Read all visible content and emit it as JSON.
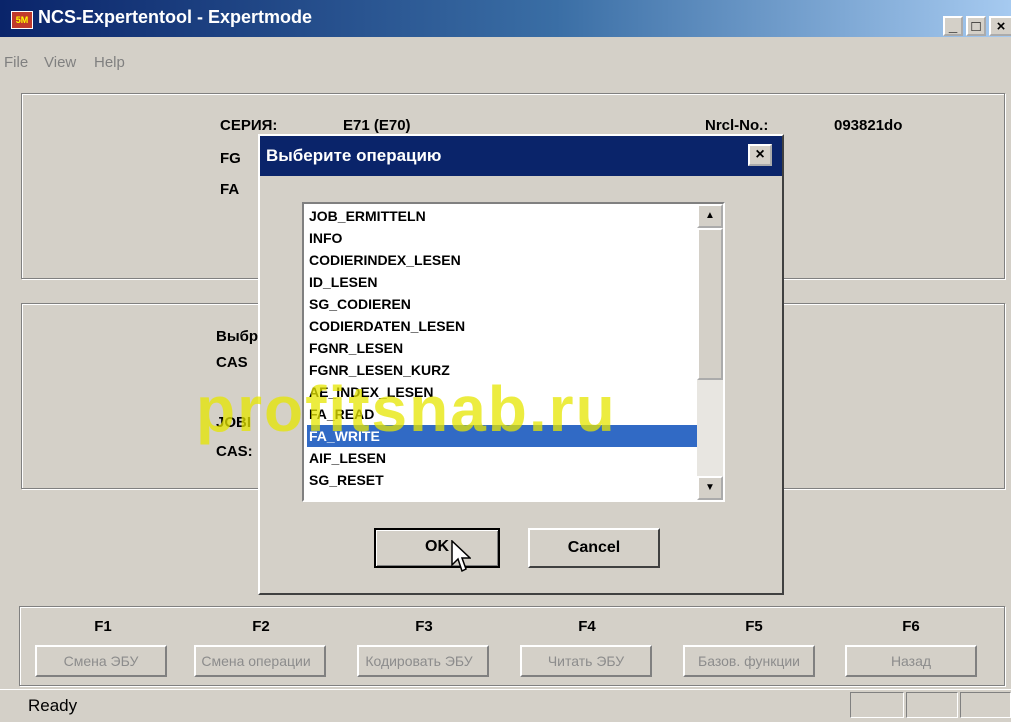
{
  "window": {
    "title": "NCS-Expertentool - Expertmode",
    "app_icon": "ncs-app-icon"
  },
  "menu": [
    "File",
    "View",
    "Help"
  ],
  "info_top": {
    "series_label": "СЕРИЯ:",
    "series_value": "E71 (E70)",
    "fg_label": "FG",
    "fa_label": "FA",
    "nrcl_label": "Nrcl-No.:",
    "nrcl_value": "093821do"
  },
  "info_mid": {
    "label1": "Выбр",
    "label2": "CAS",
    "label3": "JOBI",
    "label4": "CAS:"
  },
  "dialog": {
    "title": "Выберите операцию",
    "items": [
      "JOB_ERMITTELN",
      "INFO",
      "CODIERINDEX_LESEN",
      "ID_LESEN",
      "SG_CODIEREN",
      "CODIERDATEN_LESEN",
      "FGNR_LESEN",
      "FGNR_LESEN_KURZ",
      "AE_INDEX_LESEN",
      "FA_READ",
      "FA_WRITE",
      "AIF_LESEN",
      "SG_RESET"
    ],
    "selected": "FA_WRITE",
    "ok": "OK",
    "cancel": "Cancel"
  },
  "fkeys": [
    {
      "key": "F1",
      "label": "Смена ЭБУ"
    },
    {
      "key": "F2",
      "label": "Смена операции"
    },
    {
      "key": "F3",
      "label": "Кодировать ЭБУ"
    },
    {
      "key": "F4",
      "label": "Читать ЭБУ"
    },
    {
      "key": "F5",
      "label": "Базов. функции"
    },
    {
      "key": "F6",
      "label": "Назад"
    }
  ],
  "status": "Ready",
  "watermark": "profitsnab.ru",
  "colors": {
    "title_bar": "#0a246a",
    "selection": "#316ac5",
    "face": "#d4d0c8"
  }
}
